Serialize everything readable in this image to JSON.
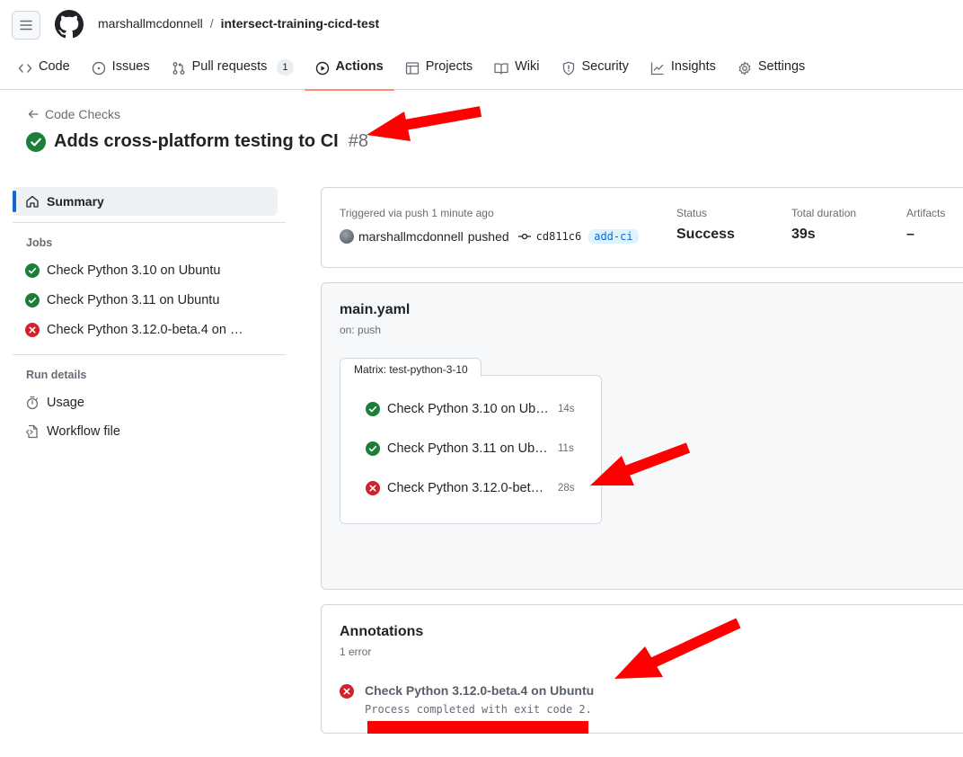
{
  "repo": {
    "owner": "marshallmcdonnell",
    "separator": "/",
    "name": "intersect-training-cicd-test"
  },
  "nav": [
    {
      "label": "Code",
      "icon": "code-icon"
    },
    {
      "label": "Issues",
      "icon": "issue-icon"
    },
    {
      "label": "Pull requests",
      "icon": "pull-request-icon",
      "count": "1"
    },
    {
      "label": "Actions",
      "icon": "play-icon",
      "active": true
    },
    {
      "label": "Projects",
      "icon": "table-icon"
    },
    {
      "label": "Wiki",
      "icon": "book-icon"
    },
    {
      "label": "Security",
      "icon": "shield-icon"
    },
    {
      "label": "Insights",
      "icon": "graph-icon"
    },
    {
      "label": "Settings",
      "icon": "gear-icon"
    }
  ],
  "back_link": "Code Checks",
  "run": {
    "title": "Adds cross-platform testing to CI",
    "number": "#8"
  },
  "sidebar": {
    "summary": "Summary",
    "jobs_heading": "Jobs",
    "jobs": [
      {
        "label": "Check Python 3.10 on Ubuntu",
        "status": "success"
      },
      {
        "label": "Check Python 3.11 on Ubuntu",
        "status": "success"
      },
      {
        "label": "Check Python 3.12.0-beta.4 on …",
        "status": "failure"
      }
    ],
    "run_details_heading": "Run details",
    "usage": "Usage",
    "workflow_file": "Workflow file"
  },
  "summary_card": {
    "triggered": "Triggered via push 1 minute ago",
    "actor": "marshallmcdonnell",
    "action": "pushed",
    "commit": "cd811c6",
    "branch": "add-ci",
    "status_label": "Status",
    "status_value": "Success",
    "duration_label": "Total duration",
    "duration_value": "39s",
    "artifacts_label": "Artifacts",
    "artifacts_value": "–"
  },
  "workflow": {
    "file": "main.yaml",
    "trigger": "on: push",
    "matrix_label": "Matrix: test-python-3-10",
    "jobs": [
      {
        "label": "Check Python 3.10 on Ubu…",
        "time": "14s",
        "status": "success"
      },
      {
        "label": "Check Python 3.11 on Ubu…",
        "time": "11s",
        "status": "success"
      },
      {
        "label": "Check Python 3.12.0-beta.…",
        "time": "28s",
        "status": "failure"
      }
    ]
  },
  "annotations": {
    "heading": "Annotations",
    "count": "1 error",
    "items": [
      {
        "title": "Check Python 3.12.0-beta.4 on Ubuntu",
        "message": "Process completed with exit code 2."
      }
    ]
  },
  "colors": {
    "success": "#1a7f37",
    "failure": "#cf222e",
    "accent": "#fd8c73",
    "link": "#0969da",
    "arrow": "#ff0000"
  }
}
